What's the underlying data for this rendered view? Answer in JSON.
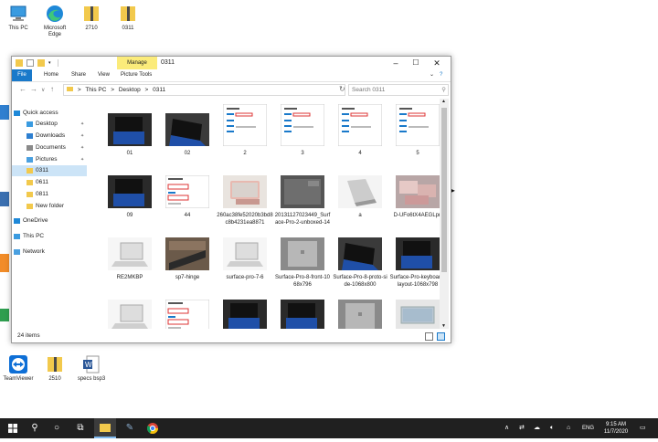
{
  "desktop": {
    "icons": [
      {
        "label": "This PC",
        "icon": "this-pc-icon"
      },
      {
        "label": "Microsoft Edge",
        "icon": "edge-icon"
      },
      {
        "label": "2710",
        "icon": "zip-folder-icon"
      },
      {
        "label": "0311",
        "icon": "zip-folder-icon"
      },
      {
        "label": "TeamViewer",
        "icon": "teamviewer-icon"
      },
      {
        "label": "2510",
        "icon": "zip-folder-icon"
      },
      {
        "label": "specs bsp3",
        "icon": "word-doc-icon"
      }
    ]
  },
  "window": {
    "title": "0311",
    "manage_label": "Manage",
    "ribbon_tabs": [
      "File",
      "Home",
      "Share",
      "View",
      "Picture Tools"
    ],
    "breadcrumb": [
      ">",
      "This PC",
      ">",
      "Desktop",
      ">",
      "0311"
    ],
    "search_placeholder": "Search 0311",
    "status": "24 items"
  },
  "nav": {
    "items": [
      {
        "label": "Quick access",
        "icon": "star-icon"
      },
      {
        "label": "Desktop",
        "icon": "desktop-folder-icon"
      },
      {
        "label": "Downloads",
        "icon": "downloads-icon"
      },
      {
        "label": "Documents",
        "icon": "documents-icon"
      },
      {
        "label": "Pictures",
        "icon": "pictures-icon"
      },
      {
        "label": "0311",
        "icon": "folder-icon"
      },
      {
        "label": "0611",
        "icon": "folder-icon"
      },
      {
        "label": "0811",
        "icon": "folder-icon"
      },
      {
        "label": "New folder",
        "icon": "folder-icon"
      },
      {
        "label": "OneDrive",
        "icon": "onedrive-icon"
      },
      {
        "label": "This PC",
        "icon": "this-pc-icon"
      },
      {
        "label": "Network",
        "icon": "network-icon"
      }
    ]
  },
  "files": [
    {
      "name": "01",
      "thumb": "tablet-blue"
    },
    {
      "name": "02",
      "thumb": "tablet-angle"
    },
    {
      "name": "2",
      "thumb": "settings-doc"
    },
    {
      "name": "3",
      "thumb": "settings-doc"
    },
    {
      "name": "4",
      "thumb": "settings-doc"
    },
    {
      "name": "5",
      "thumb": "settings-doc"
    },
    {
      "name": "09",
      "thumb": "tablet-blue"
    },
    {
      "name": "44",
      "thumb": "settings-wide"
    },
    {
      "name": "260ac38fe52020b3bd8c8b4231ea8871",
      "thumb": "rose-laptop"
    },
    {
      "name": "20131127023449_Surface-Pro-2-unboxed-14",
      "thumb": "gray-surface"
    },
    {
      "name": "a",
      "thumb": "white-device"
    },
    {
      "name": "D-UFo6tX4AEGLpn",
      "thumb": "pink-devices"
    },
    {
      "name": "RE2MKBP",
      "thumb": "white-laptop"
    },
    {
      "name": "sp7-hinge",
      "thumb": "hinge"
    },
    {
      "name": "surface-pro-7-6",
      "thumb": "white-laptop"
    },
    {
      "name": "Surface-Pro-8-front-1068x796",
      "thumb": "silver-back"
    },
    {
      "name": "Surface-Pro-8-proto-side-1068x800",
      "thumb": "tablet-angle"
    },
    {
      "name": "Surface-Pro-keyboard-layout-1068x798",
      "thumb": "tablet-blue"
    },
    {
      "name": "",
      "thumb": "white-laptop"
    },
    {
      "name": "",
      "thumb": "settings-wide"
    },
    {
      "name": "",
      "thumb": "tablet-blue"
    },
    {
      "name": "",
      "thumb": "tablet-blue"
    },
    {
      "name": "",
      "thumb": "silver-back"
    },
    {
      "name": "",
      "thumb": "silver-laptop"
    }
  ],
  "taskbar": {
    "time": "9:15 AM",
    "date": "11/7/2020",
    "language": "ENG"
  },
  "colors": {
    "accent": "#1979ca",
    "manage": "#fbeb7a",
    "selection": "#cce4f7",
    "taskbar": "#202020"
  }
}
